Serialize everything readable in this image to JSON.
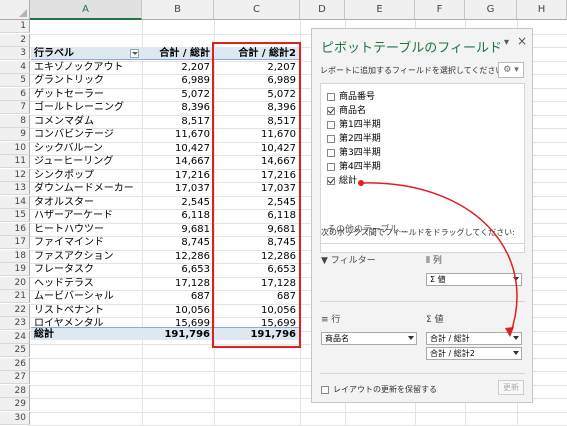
{
  "columns": [
    "A",
    "B",
    "C",
    "D",
    "E",
    "F",
    "G",
    "H"
  ],
  "selected_column": "A",
  "row_numbers": [
    "1",
    "2",
    "3",
    "4",
    "5",
    "6",
    "7",
    "8",
    "9",
    "10",
    "11",
    "12",
    "13",
    "14",
    "15",
    "16",
    "17",
    "18",
    "19",
    "20",
    "21",
    "22",
    "23",
    "24",
    "25",
    "26",
    "27",
    "28",
    "29",
    "30"
  ],
  "pivot": {
    "header": {
      "label": "行ラベル",
      "col1": "合計 / 総計",
      "col2": "合計 / 総計2"
    },
    "rows": [
      {
        "name": "エキゾノックアウト",
        "v1": "2,207",
        "v2": "2,207"
      },
      {
        "name": "グラントリック",
        "v1": "6,989",
        "v2": "6,989"
      },
      {
        "name": "ゲットセーラー",
        "v1": "5,072",
        "v2": "5,072"
      },
      {
        "name": "ゴールトレーニング",
        "v1": "8,396",
        "v2": "8,396"
      },
      {
        "name": "コメンマダム",
        "v1": "8,517",
        "v2": "8,517"
      },
      {
        "name": "コンバビンテージ",
        "v1": "11,670",
        "v2": "11,670"
      },
      {
        "name": "シックバルーン",
        "v1": "10,427",
        "v2": "10,427"
      },
      {
        "name": "ジューヒーリング",
        "v1": "14,667",
        "v2": "14,667"
      },
      {
        "name": "シンクポップ",
        "v1": "17,216",
        "v2": "17,216"
      },
      {
        "name": "ダウンムードメーカー",
        "v1": "17,037",
        "v2": "17,037"
      },
      {
        "name": "タオルスター",
        "v1": "2,545",
        "v2": "2,545"
      },
      {
        "name": "ハザーアーケード",
        "v1": "6,118",
        "v2": "6,118"
      },
      {
        "name": "ヒートハウツー",
        "v1": "9,681",
        "v2": "9,681"
      },
      {
        "name": "ファイマインド",
        "v1": "8,745",
        "v2": "8,745"
      },
      {
        "name": "ファスアクション",
        "v1": "12,286",
        "v2": "12,286"
      },
      {
        "name": "フレータスク",
        "v1": "6,653",
        "v2": "6,653"
      },
      {
        "name": "ヘッドテラス",
        "v1": "17,128",
        "v2": "17,128"
      },
      {
        "name": "ムービバーシャル",
        "v1": "687",
        "v2": "687"
      },
      {
        "name": "リストペナント",
        "v1": "10,056",
        "v2": "10,056"
      },
      {
        "name": "ロイヤメンタル",
        "v1": "15,699",
        "v2": "15,699"
      }
    ],
    "total": {
      "label": "総計",
      "v1": "191,796",
      "v2": "191,796"
    }
  },
  "pane": {
    "title": "ピボットテーブルのフィールド",
    "subtitle": "レポートに追加するフィールドを選択してください:",
    "dropdown_glyph": "▾",
    "close_glyph": "×",
    "gear_glyph": "⚙ ▾",
    "fields": [
      {
        "label": "商品番号",
        "checked": false
      },
      {
        "label": "商品名",
        "checked": true
      },
      {
        "label": "第1四半期",
        "checked": false
      },
      {
        "label": "第2四半期",
        "checked": false
      },
      {
        "label": "第3四半期",
        "checked": false
      },
      {
        "label": "第4四半期",
        "checked": false
      },
      {
        "label": "総計",
        "checked": true
      }
    ],
    "more_tables": "その他のテーブル...",
    "drag_hint": "次のボックス間でフィールドをドラッグしてください:",
    "areas": {
      "filters": {
        "header": "フィルター"
      },
      "columns": {
        "header": "列",
        "items": [
          "Σ 値"
        ]
      },
      "rows": {
        "header": "行",
        "items": [
          "商品名"
        ]
      },
      "values": {
        "header": "Σ 値",
        "items": [
          "合計 / 総計",
          "合計 / 総計2"
        ]
      }
    },
    "defer_label": "レイアウトの更新を保留する",
    "update_button": "更新"
  },
  "colors": {
    "accent": "#217346",
    "highlight": "#e02020",
    "pivot_header": "#dde8f0"
  }
}
